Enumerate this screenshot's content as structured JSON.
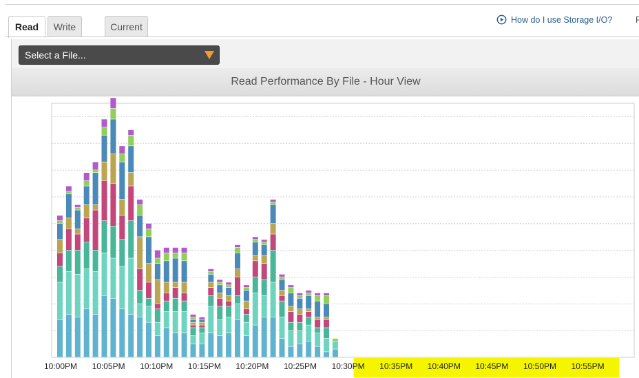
{
  "tabs": [
    {
      "label": "Read",
      "active": true
    },
    {
      "label": "Write",
      "active": false
    },
    {
      "label": "Current",
      "active": false
    }
  ],
  "help_link": "How do I use Storage I/O?",
  "cut_text": "F",
  "file_select": {
    "placeholder": "Select a File..."
  },
  "colors": {
    "accent_orange": "#f29a2e",
    "highlight_yellow": "#f5f500",
    "series": [
      "#5fb3cf",
      "#6ed4c0",
      "#49b69a",
      "#c2477a",
      "#bca552",
      "#4b89b8",
      "#8fcf5a",
      "#b25ac9"
    ]
  },
  "chart_data": {
    "type": "bar",
    "title": "Read Performance By File - Hour View",
    "stacked": true,
    "grid": true,
    "y_axis_labels": false,
    "ylim": [
      0,
      9.5
    ],
    "x_tick_labels": [
      "10:00PM",
      "10:05PM",
      "10:10PM",
      "10:15PM",
      "10:20PM",
      "10:25PM",
      "10:30PM",
      "10:35PM",
      "10:40PM",
      "10:45PM",
      "10:50PM",
      "10:55PM"
    ],
    "highlighted_ticks": [
      "10:30PM",
      "10:35PM",
      "10:40PM",
      "10:45PM",
      "10:50PM",
      "10:55PM"
    ],
    "bars": [
      [
        1.4,
        1.4,
        0.6,
        0.5,
        0.5,
        0.6,
        0.1,
        0.2
      ],
      [
        1.6,
        1.6,
        0.8,
        0.8,
        0.4,
        0.9,
        0.1,
        0.2
      ],
      [
        1.5,
        1.6,
        0.9,
        0.6,
        0.2,
        0.7,
        0.1,
        0.1
      ],
      [
        1.8,
        1.5,
        1.0,
        0.9,
        0.5,
        0.7,
        0.2,
        0.3
      ],
      [
        1.6,
        1.6,
        0.8,
        1.5,
        0.2,
        1.2,
        0.1,
        0.3
      ],
      [
        2.3,
        1.6,
        1.2,
        1.5,
        0.7,
        1.0,
        0.3,
        0.3
      ],
      [
        2.2,
        1.5,
        1.2,
        1.6,
        1.1,
        1.3,
        0.4,
        0.4
      ],
      [
        1.8,
        1.6,
        1.0,
        0.9,
        0.6,
        1.4,
        0.3,
        0.3
      ],
      [
        1.6,
        2.1,
        1.4,
        1.3,
        0.5,
        1.0,
        0.4,
        0.2
      ],
      [
        1.5,
        0.5,
        0.5,
        0.8,
        1.2,
        0.8,
        0.4,
        0.2
      ],
      [
        1.3,
        0.6,
        0.3,
        0.6,
        0.7,
        1.0,
        0.3,
        0.2
      ],
      [
        0.8,
        0.5,
        0.5,
        0.2,
        0.9,
        0.6,
        0.2,
        0.3
      ],
      [
        1.1,
        0.6,
        0.4,
        0.3,
        0.4,
        0.8,
        0.3,
        0.2
      ],
      [
        0.9,
        0.8,
        0.5,
        0.4,
        0.2,
        0.9,
        0.2,
        0.2
      ],
      [
        0.9,
        0.8,
        0.4,
        0.3,
        0.4,
        0.8,
        0.3,
        0.2
      ],
      [
        0.5,
        0.3,
        0.3,
        0.1,
        0.1,
        0.1,
        0.1,
        0.1
      ],
      [
        0.5,
        0.4,
        0.2,
        0.1,
        0.1,
        0.1,
        0.0,
        0.1
      ],
      [
        0.9,
        1.0,
        0.4,
        0.3,
        0.2,
        0.3,
        0.1,
        0.1
      ],
      [
        0.8,
        0.6,
        0.5,
        0.3,
        0.2,
        0.3,
        0.1,
        0.1
      ],
      [
        0.9,
        0.6,
        0.4,
        0.2,
        0.2,
        0.3,
        0.1,
        0.1
      ],
      [
        1.4,
        0.6,
        0.3,
        0.7,
        0.3,
        0.6,
        0.2,
        0.1
      ],
      [
        0.8,
        0.5,
        0.3,
        0.2,
        0.3,
        0.4,
        0.1,
        0.1
      ],
      [
        1.2,
        1.2,
        0.6,
        0.6,
        0.2,
        0.5,
        0.1,
        0.1
      ],
      [
        1.5,
        0.8,
        0.6,
        0.6,
        0.3,
        0.4,
        0.1,
        0.1
      ],
      [
        1.5,
        1.3,
        1.2,
        0.6,
        0.4,
        0.7,
        0.1,
        0.1
      ],
      [
        0.7,
        0.8,
        0.6,
        0.2,
        0.2,
        0.4,
        0.1,
        0.1
      ],
      [
        0.4,
        0.6,
        0.3,
        0.4,
        0.2,
        0.5,
        0.2,
        0.1
      ],
      [
        0.5,
        0.5,
        0.3,
        0.3,
        0.2,
        0.4,
        0.1,
        0.1
      ],
      [
        0.6,
        0.6,
        0.3,
        0.2,
        0.1,
        0.5,
        0.1,
        0.1
      ],
      [
        0.4,
        0.5,
        0.2,
        0.3,
        0.1,
        0.6,
        0.2,
        0.1
      ],
      [
        0.2,
        0.5,
        0.4,
        0.3,
        0.1,
        0.5,
        0.3,
        0.1
      ],
      [
        0.3,
        0.3,
        0.0,
        0.0,
        0.0,
        0.0,
        0.1,
        0.0
      ]
    ]
  }
}
